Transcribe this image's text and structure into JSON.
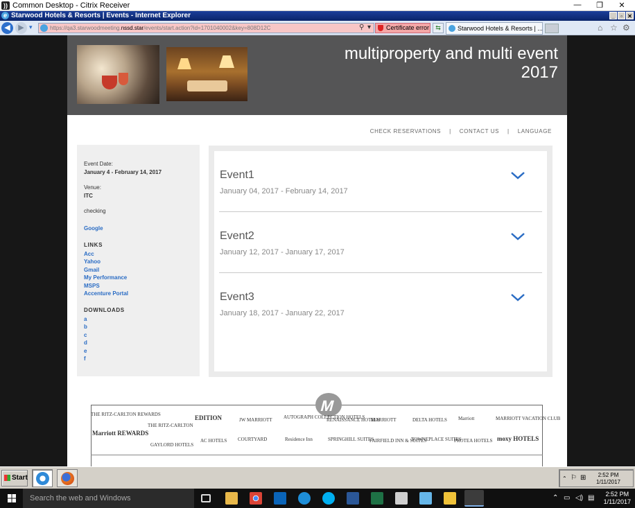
{
  "citrix": {
    "title": "Common Desktop - Citrix Receiver",
    "min": "—",
    "restore": "❐",
    "close": "✕"
  },
  "ie": {
    "title": "Starwood Hotels & Resorts | Events - Internet Explorer",
    "url_prefix": "https://qa3.starwoodmeeting.",
    "url_host": "nssd.star",
    "url_rest": "/events/start.action?id=1701040002&key=808D12C",
    "cert_error": "Certificate error",
    "tab_title": "Starwood Hotels & Resorts | ..."
  },
  "banner": {
    "title_line1": "multiproperty and multi event",
    "title_line2": "2017"
  },
  "topnav": {
    "check_reservations": "CHECK RESERVATIONS",
    "contact_us": "CONTACT US",
    "language": "LANGUAGE",
    "separator": "|"
  },
  "sidebar": {
    "event_date_label": "Event Date:",
    "event_date_value": "January 4 - February 14, 2017",
    "venue_label": "Venue:",
    "venue_value": "ITC",
    "note": "checking",
    "google": "Google",
    "links_heading": "LINKS",
    "links": [
      "Acc",
      "Yahoo",
      "Gmail",
      "My Performance",
      "MSPS",
      "Accenture Portal"
    ],
    "downloads_heading": "DOWNLOADS",
    "downloads": [
      "a",
      "b",
      "c",
      "d",
      "e",
      "f"
    ]
  },
  "events": [
    {
      "name": "Event1",
      "dates": "January 04, 2017 - February 14, 2017"
    },
    {
      "name": "Event2",
      "dates": "January 12, 2017 - January 17, 2017"
    },
    {
      "name": "Event3",
      "dates": "January 18, 2017 - January 22, 2017"
    }
  ],
  "brands": {
    "ritz_carlton": "THE RITZ-CARLTON REWARDS",
    "ritz_small": "THE RITZ-CARLTON",
    "edition": "EDITION",
    "jw": "JW MARRIOTT",
    "autograph": "AUTOGRAPH COLLECTION HOTELS",
    "renaissance": "RENAISSANCE HOTELS",
    "marriott_m": "MARRIOTT",
    "delta": "DELTA HOTELS",
    "marriott_hotels": "Marriott",
    "marriott_vacation": "MARRIOTT VACATION CLUB",
    "marriott_rewards": "Marriott REWARDS",
    "gaylord": "GAYLORD HOTELS",
    "ac": "AC HOTELS",
    "courtyard": "COURTYARD",
    "residence": "Residence Inn",
    "springhill": "SPRINGHILL SUITES",
    "fairfield": "FAIRFIELD INN & SUITES",
    "towneplace": "TOWNEPLACE SUITES",
    "protea": "PROTEA HOTELS",
    "moxy": "moxy HOTELS"
  },
  "xp_taskbar": {
    "start": "Start",
    "time": "2:52 PM",
    "date": "1/11/2017"
  },
  "win10": {
    "search_placeholder": "Search the web and Windows",
    "time": "2:52 PM",
    "date": "1/11/2017"
  }
}
